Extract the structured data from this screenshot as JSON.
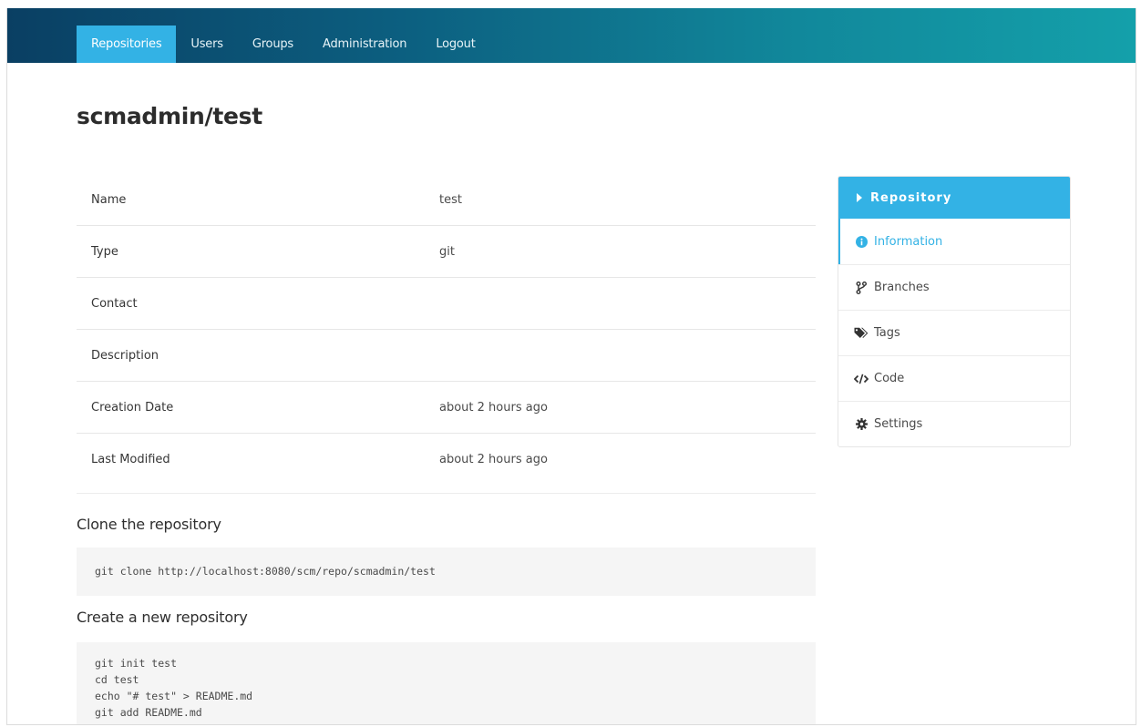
{
  "navbar": {
    "items": [
      {
        "label": "Repositories",
        "active": true
      },
      {
        "label": "Users"
      },
      {
        "label": "Groups"
      },
      {
        "label": "Administration"
      },
      {
        "label": "Logout"
      }
    ]
  },
  "page": {
    "title": "scmadmin/test"
  },
  "info": {
    "rows": [
      {
        "key": "Name",
        "value": "test"
      },
      {
        "key": "Type",
        "value": "git"
      },
      {
        "key": "Contact",
        "value": ""
      },
      {
        "key": "Description",
        "value": ""
      },
      {
        "key": "Creation Date",
        "value": "about 2 hours ago"
      },
      {
        "key": "Last Modified",
        "value": "about 2 hours ago"
      }
    ]
  },
  "clone": {
    "heading": "Clone the repository",
    "command": "git clone http://localhost:8080/scm/repo/scmadmin/test"
  },
  "create": {
    "heading": "Create a new repository",
    "code": "git init test\ncd test\necho \"# test\" > README.md\ngit add README.md"
  },
  "sidebar": {
    "header": "Repository",
    "items": [
      {
        "label": "Information",
        "icon": "info-circle-icon",
        "active": true
      },
      {
        "label": "Branches",
        "icon": "branch-icon"
      },
      {
        "label": "Tags",
        "icon": "tags-icon"
      },
      {
        "label": "Code",
        "icon": "code-icon"
      },
      {
        "label": "Settings",
        "icon": "gear-icon"
      }
    ]
  },
  "colors": {
    "accent": "#33b2e5",
    "navbar_dark": "#0a3f63",
    "navbar_light": "#14a0aa"
  }
}
